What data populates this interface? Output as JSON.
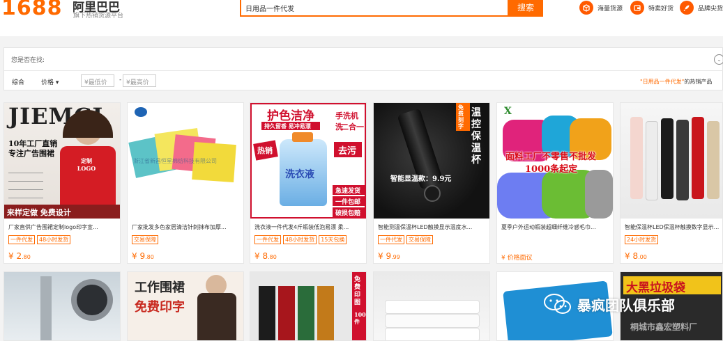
{
  "header": {
    "logo_number": "1688",
    "logo_name": "阿里巴巴",
    "logo_sub": "旗下热销货源平台",
    "search_value": "日用品一件代发",
    "search_button": "搜索",
    "links": [
      {
        "label": "海量货源",
        "icon": "box-icon"
      },
      {
        "label": "特卖好货",
        "icon": "wallet-icon"
      },
      {
        "label": "品牌尖货",
        "icon": "rocket-icon"
      }
    ]
  },
  "filters": {
    "maybe_label": "您是否在找:",
    "sort_default": "综合",
    "sort_price": "价格 ▾",
    "min_price_placeholder": "¥最低价",
    "max_price_placeholder": "¥最高价",
    "range_dash": "-",
    "hot_query": "\"日用品一件代发\"",
    "hot_suffix": "的热销产品"
  },
  "products": [
    {
      "title": "厂家直供广告围裙定制logo印字宣...",
      "tags": [
        "一件代发",
        "48小时发货"
      ],
      "price_int": "2",
      "price_dec": ".80"
    },
    {
      "title": "厂家批发多色家居清洁针刺抹布加厚...",
      "tags": [
        "交易保障"
      ],
      "price_int": "9",
      "price_dec": ".80"
    },
    {
      "title": "洗衣液一件代发4斤瓶装低泡易漂 柔...",
      "tags": [
        "一件代发",
        "48小时发货",
        "15天包换"
      ],
      "price_int": "8",
      "price_dec": ".80"
    },
    {
      "title": "智能测温保温杯LED触摸显示温度水...",
      "tags": [
        "一件代发",
        "交易保障"
      ],
      "price_int": "9",
      "price_dec": ".99"
    },
    {
      "title": "夏季户外运动瓶装超细纤维冷感毛巾...",
      "tags": [],
      "price_text": "¥ 价格面议"
    },
    {
      "title": "智能保温杯LED保温杯触摸数字显示...",
      "tags": [
        "24小时发货"
      ],
      "price_int": "8",
      "price_dec": ".00"
    }
  ],
  "image_texts": {
    "apron_brand": "JIEMCI",
    "apron_line1": "10年工厂直销",
    "apron_line2": "专注广告围裙",
    "apron_bottom": "来样定做  免费设计",
    "apron_logo": "定制 LOGO",
    "cloth_company": "浙江省新昌恒星棉纺科技有限公司",
    "detergent_top": "护色洁净",
    "detergent_sub": "持久留香 易冲易漂",
    "detergent_side1": "手洗机洗",
    "detergent_side2": "二合一",
    "detergent_hot": "热销",
    "detergent_stain": "去污",
    "detergent_brand": "洗衣液",
    "detergent_tag1": "急速发货",
    "detergent_tag2": "一件包邮",
    "detergent_tag3": "破损包赔",
    "bottle_free": "免费刻字",
    "bottle_title": "温控保温杯",
    "bottle_price": "智能显温款：9.9元",
    "towel_text1": "面料工厂不零售不批发",
    "towel_text2": "1000条起定",
    "apron2_line1": "工作围裙",
    "apron2_line2": "免费印字",
    "apron3_side": "免费印图",
    "apron3_side2": "100件",
    "trash_title": "大黑垃圾袋",
    "trash_company": "桐城市鑫宏塑料厂",
    "watermark": "暴疯团队俱乐部"
  }
}
